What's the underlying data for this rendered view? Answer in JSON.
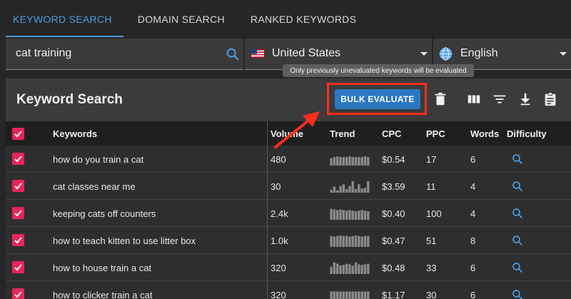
{
  "tabs": [
    {
      "label": "KEYWORD SEARCH",
      "active": true
    },
    {
      "label": "DOMAIN SEARCH",
      "active": false
    },
    {
      "label": "RANKED KEYWORDS",
      "active": false
    }
  ],
  "search": {
    "value": "cat training"
  },
  "country": {
    "label": "United States"
  },
  "language": {
    "label": "English"
  },
  "tooltip": "Only previously unevaluated keywords will be evaluated",
  "panel": {
    "title": "Keyword Search",
    "bulk_label": "BULK EVALUATE"
  },
  "columns": [
    "Keywords",
    "Volume",
    "Trend",
    "CPC",
    "PPC",
    "Words",
    "Difficulty"
  ],
  "rows": [
    {
      "keyword": "how do you train a cat",
      "volume": "480",
      "cpc": "$0.54",
      "ppc": "17",
      "words": "6",
      "trend": [
        0.6,
        0.7,
        0.75,
        0.7,
        0.7,
        0.7,
        0.75,
        0.7,
        0.7,
        0.7,
        0.7,
        0.75,
        0.7
      ]
    },
    {
      "keyword": "cat classes near me",
      "volume": "30",
      "cpc": "$3.59",
      "ppc": "11",
      "words": "4",
      "trend": [
        0.25,
        0.5,
        0.2,
        0.55,
        0.7,
        0.3,
        0.55,
        0.95,
        0.3,
        0.7,
        0.35,
        0.4,
        0.95
      ]
    },
    {
      "keyword": "keeping cats off counters",
      "volume": "2.4k",
      "cpc": "$0.40",
      "ppc": "100",
      "words": "4",
      "trend": [
        0.9,
        0.85,
        0.8,
        0.85,
        0.8,
        0.75,
        0.8,
        0.75,
        0.7,
        0.75,
        0.8,
        0.75,
        0.7
      ]
    },
    {
      "keyword": "how to teach kitten to use litter box",
      "volume": "1.0k",
      "cpc": "$0.47",
      "ppc": "51",
      "words": "8",
      "trend": [
        0.9,
        0.85,
        0.9,
        0.95,
        0.9,
        0.9,
        0.85,
        0.9,
        0.95,
        0.9,
        0.85,
        0.9,
        0.9
      ]
    },
    {
      "keyword": "how to house train a cat",
      "volume": "320",
      "cpc": "$0.48",
      "ppc": "33",
      "words": "6",
      "trend": [
        0.6,
        0.95,
        0.85,
        0.7,
        0.75,
        0.85,
        0.8,
        0.7,
        0.95,
        0.8,
        0.75,
        0.8,
        0.85
      ]
    },
    {
      "keyword": "how to clicker train a cat",
      "volume": "320",
      "cpc": "$1.17",
      "ppc": "30",
      "words": "6",
      "trend": [
        0.8,
        0.8,
        0.8,
        0.8,
        0.8,
        0.8,
        0.8,
        0.8,
        0.8,
        0.8,
        0.8,
        0.8,
        0.8
      ]
    }
  ],
  "colors": {
    "accent": "#4a9fe4",
    "checkbox": "#e8255a",
    "button": "#2b78c2",
    "highlight": "#ff2d1a",
    "trend_bar": "#8a8a8a"
  },
  "icons": [
    "search-icon",
    "us-flag-icon",
    "globe-icon",
    "trash-icon",
    "columns-icon",
    "filter-icon",
    "download-icon",
    "clipboard-icon",
    "magnifier-icon"
  ]
}
